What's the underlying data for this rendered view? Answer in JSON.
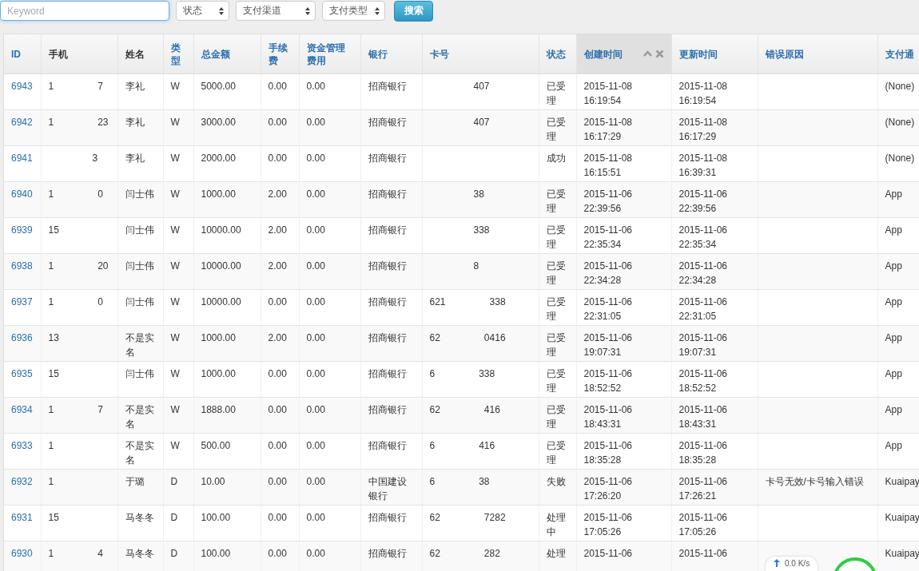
{
  "filters": {
    "keyword": {
      "placeholder": "Keyword"
    },
    "selects": [
      {
        "label": "状态"
      },
      {
        "label": "支付渠道"
      },
      {
        "label": "支付类型"
      }
    ],
    "search_button": "搜索"
  },
  "table": {
    "columns": [
      {
        "label": "ID",
        "sortable": true,
        "sorted": false
      },
      {
        "label": "手机",
        "sortable": false,
        "sorted": false
      },
      {
        "label": "姓名",
        "sortable": false,
        "sorted": false
      },
      {
        "label": "类型",
        "sortable": true,
        "sorted": false
      },
      {
        "label": "总金额",
        "sortable": true,
        "sorted": false
      },
      {
        "label": "手续费",
        "sortable": true,
        "sorted": false
      },
      {
        "label": "资金管理费用",
        "sortable": true,
        "sorted": false
      },
      {
        "label": "银行",
        "sortable": true,
        "sorted": false
      },
      {
        "label": "卡号",
        "sortable": true,
        "sorted": false
      },
      {
        "label": "状态",
        "sortable": true,
        "sorted": false
      },
      {
        "label": "创建时间",
        "sortable": true,
        "sorted": true
      },
      {
        "label": "更新时间",
        "sortable": true,
        "sorted": false
      },
      {
        "label": "错误原因",
        "sortable": true,
        "sorted": false
      },
      {
        "label": "支付通",
        "sortable": true,
        "sorted": false
      }
    ],
    "rows": [
      {
        "id": "6943",
        "phone": {
          "start": "1",
          "end": "7"
        },
        "name": "李礼",
        "type": "W",
        "total": "5000.00",
        "fee": "0.00",
        "mgmt_fee": "0.00",
        "bank": "招商银行",
        "card": {
          "end": "407"
        },
        "status": "已受理",
        "created": [
          "2015-11-08",
          "16:19:54"
        ],
        "updated": [
          "2015-11-08",
          "16:19:54"
        ],
        "channel": "(None)"
      },
      {
        "id": "6942",
        "phone": {
          "start": "1",
          "end": "23"
        },
        "name": "李礼",
        "type": "W",
        "total": "3000.00",
        "fee": "0.00",
        "mgmt_fee": "0.00",
        "bank": "招商银行",
        "card": {
          "end": "407"
        },
        "status": "已受理",
        "created": [
          "2015-11-08",
          "16:17:29"
        ],
        "updated": [
          "2015-11-08",
          "16:17:29"
        ],
        "channel": "(None)"
      },
      {
        "id": "6941",
        "phone": {
          "end": "3"
        },
        "name": "李礼",
        "type": "W",
        "total": "2000.00",
        "fee": "0.00",
        "mgmt_fee": "0.00",
        "bank": "招商银行",
        "card": {},
        "status": "成功",
        "created": [
          "2015-11-08",
          "16:15:51"
        ],
        "updated": [
          "2015-11-08",
          "16:39:31"
        ],
        "channel": "(None)"
      },
      {
        "id": "6940",
        "phone": {
          "start": "1",
          "end": "0"
        },
        "name": "闫士伟",
        "type": "W",
        "total": "1000.00",
        "fee": "2.00",
        "mgmt_fee": "0.00",
        "bank": "招商银行",
        "card": {
          "end": "38"
        },
        "status": "已受理",
        "created": [
          "2015-11-06",
          "22:39:56"
        ],
        "updated": [
          "2015-11-06",
          "22:39:56"
        ],
        "channel": "App"
      },
      {
        "id": "6939",
        "phone": {
          "start": "15"
        },
        "name": "闫士伟",
        "type": "W",
        "total": "10000.00",
        "fee": "2.00",
        "mgmt_fee": "0.00",
        "bank": "招商银行",
        "card": {
          "end": "338"
        },
        "status": "已受理",
        "created": [
          "2015-11-06",
          "22:35:34"
        ],
        "updated": [
          "2015-11-06",
          "22:35:34"
        ],
        "channel": "App"
      },
      {
        "id": "6938",
        "phone": {
          "start": "1",
          "end": "20"
        },
        "name": "闫士伟",
        "type": "W",
        "total": "10000.00",
        "fee": "2.00",
        "mgmt_fee": "0.00",
        "bank": "招商银行",
        "card": {
          "end": "8"
        },
        "status": "已受理",
        "created": [
          "2015-11-06",
          "22:34:28"
        ],
        "updated": [
          "2015-11-06",
          "22:34:28"
        ],
        "channel": "App"
      },
      {
        "id": "6937",
        "phone": {
          "start": "1",
          "end": "0"
        },
        "name": "闫士伟",
        "type": "W",
        "total": "10000.00",
        "fee": "0.00",
        "mgmt_fee": "0.00",
        "bank": "招商银行",
        "card": {
          "start": "621",
          "end": "338"
        },
        "status": "已受理",
        "created": [
          "2015-11-06",
          "22:31:05"
        ],
        "updated": [
          "2015-11-06",
          "22:31:05"
        ],
        "channel": "App"
      },
      {
        "id": "6936",
        "phone": {
          "start": "13"
        },
        "name": "不是实名",
        "type": "W",
        "total": "1000.00",
        "fee": "2.00",
        "mgmt_fee": "0.00",
        "bank": "招商银行",
        "card": {
          "start": "62",
          "end": "0416"
        },
        "status": "已受理",
        "created": [
          "2015-11-06",
          "19:07:31"
        ],
        "updated": [
          "2015-11-06",
          "19:07:31"
        ],
        "channel": "App"
      },
      {
        "id": "6935",
        "phone": {
          "start": "15"
        },
        "name": "闫士伟",
        "type": "W",
        "total": "1000.00",
        "fee": "0.00",
        "mgmt_fee": "0.00",
        "bank": "招商银行",
        "card": {
          "start": "6",
          "end": "338"
        },
        "status": "已受理",
        "created": [
          "2015-11-06",
          "18:52:52"
        ],
        "updated": [
          "2015-11-06",
          "18:52:52"
        ],
        "channel": "App"
      },
      {
        "id": "6934",
        "phone": {
          "start": "1",
          "end": "7"
        },
        "name": "不是实名",
        "type": "W",
        "total": "1888.00",
        "fee": "0.00",
        "mgmt_fee": "0.00",
        "bank": "招商银行",
        "card": {
          "start": "62",
          "end": "416"
        },
        "status": "已受理",
        "created": [
          "2015-11-06",
          "18:43:31"
        ],
        "updated": [
          "2015-11-06",
          "18:43:31"
        ],
        "channel": "App"
      },
      {
        "id": "6933",
        "phone": {
          "start": "1"
        },
        "name": "不是实名",
        "type": "W",
        "total": "500.00",
        "fee": "0.00",
        "mgmt_fee": "0.00",
        "bank": "招商银行",
        "card": {
          "start": "6",
          "end": "416"
        },
        "status": "已受理",
        "created": [
          "2015-11-06",
          "18:35:28"
        ],
        "updated": [
          "2015-11-06",
          "18:35:28"
        ],
        "channel": "App"
      },
      {
        "id": "6932",
        "phone": {
          "start": "1"
        },
        "name": "于璐",
        "type": "D",
        "total": "10.00",
        "fee": "0.00",
        "mgmt_fee": "0.00",
        "bank": "中国建设银行",
        "card": {
          "start": "6",
          "end": "38"
        },
        "status": "失败",
        "created": [
          "2015-11-06",
          "17:26:20"
        ],
        "updated": [
          "2015-11-06",
          "17:26:21"
        ],
        "error": "卡号无效/卡号输入错误",
        "channel": "Kuaipay"
      },
      {
        "id": "6931",
        "phone": {
          "start": "15"
        },
        "name": "马冬冬",
        "type": "D",
        "total": "100.00",
        "fee": "0.00",
        "mgmt_fee": "0.00",
        "bank": "招商银行",
        "card": {
          "start": "62",
          "end": "7282"
        },
        "status": "处理中",
        "created": [
          "2015-11-06",
          "17:05:26"
        ],
        "updated": [
          "2015-11-06",
          "17:05:26"
        ],
        "channel": "Kuaipay"
      },
      {
        "id": "6930",
        "phone": {
          "start": "1",
          "end": "4"
        },
        "name": "马冬冬",
        "type": "D",
        "total": "100.00",
        "fee": "0.00",
        "mgmt_fee": "0.00",
        "bank": "招商银行",
        "card": {
          "start": "62",
          "end": "282"
        },
        "status": "处理",
        "created": [
          "2015-11-06"
        ],
        "updated": [
          "2015-11-06"
        ],
        "channel": "Kuaipay"
      }
    ]
  },
  "net_monitor": {
    "reading": "0.0 K/s"
  }
}
